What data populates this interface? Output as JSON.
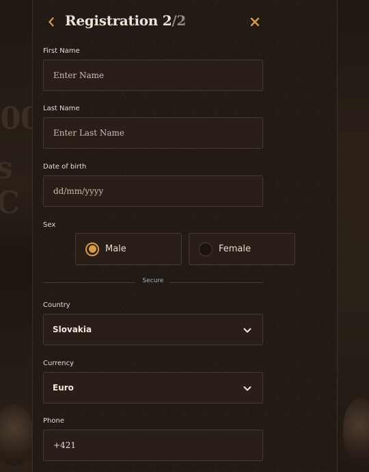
{
  "background": {
    "text_line1": "00",
    "text_line2": "s C"
  },
  "header": {
    "title": "Registration 2",
    "separator": "/",
    "total": "2",
    "back_icon": "chevron-left-icon",
    "close_icon": "close-icon"
  },
  "fields": {
    "first_name": {
      "label": "First Name",
      "placeholder": "Enter Name",
      "value": ""
    },
    "last_name": {
      "label": "Last Name",
      "placeholder": "Enter Last Name",
      "value": ""
    },
    "dob": {
      "label": "Date of birth",
      "placeholder": "dd/mm/yyyy",
      "value": ""
    },
    "sex": {
      "label": "Sex",
      "options": [
        {
          "label": "Male",
          "selected": true
        },
        {
          "label": "Female",
          "selected": false
        }
      ]
    },
    "divider_text": "Secure",
    "country": {
      "label": "Country",
      "value": "Slovakia"
    },
    "currency": {
      "label": "Currency",
      "value": "Euro"
    },
    "phone": {
      "label": "Phone",
      "value": "+421"
    }
  },
  "colors": {
    "accent": "#d99b4a",
    "secure": "#9db6c3",
    "panel": "#221a14"
  }
}
